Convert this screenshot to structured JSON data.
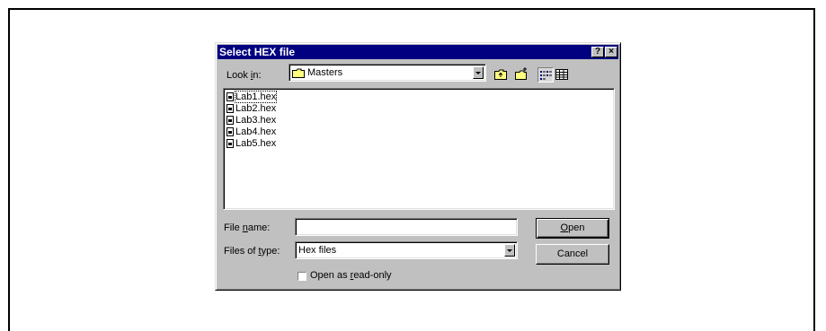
{
  "dialog": {
    "title": "Select HEX file",
    "help_button": "?",
    "close_button": "×"
  },
  "look_in": {
    "label_pre": "Look ",
    "label_accel": "i",
    "label_post": "n:",
    "value": "Masters"
  },
  "toolbar": {
    "icons": [
      "up-one-level-icon",
      "create-new-folder-icon",
      "list-view-icon",
      "details-view-icon"
    ]
  },
  "files": [
    {
      "name": "Lab1.hex"
    },
    {
      "name": "Lab2.hex"
    },
    {
      "name": "Lab3.hex"
    },
    {
      "name": "Lab4.hex"
    },
    {
      "name": "Lab5.hex"
    }
  ],
  "file_name": {
    "label_pre": "File ",
    "label_accel": "n",
    "label_post": "ame:",
    "value": ""
  },
  "file_type": {
    "label_pre": "Files of ",
    "label_accel": "t",
    "label_post": "ype:",
    "value": "Hex files"
  },
  "buttons": {
    "open_accel": "O",
    "open_rest": "pen",
    "cancel": "Cancel"
  },
  "readonly": {
    "label_pre": "Open as ",
    "label_accel": "r",
    "label_post": "ead-only",
    "checked": false
  }
}
